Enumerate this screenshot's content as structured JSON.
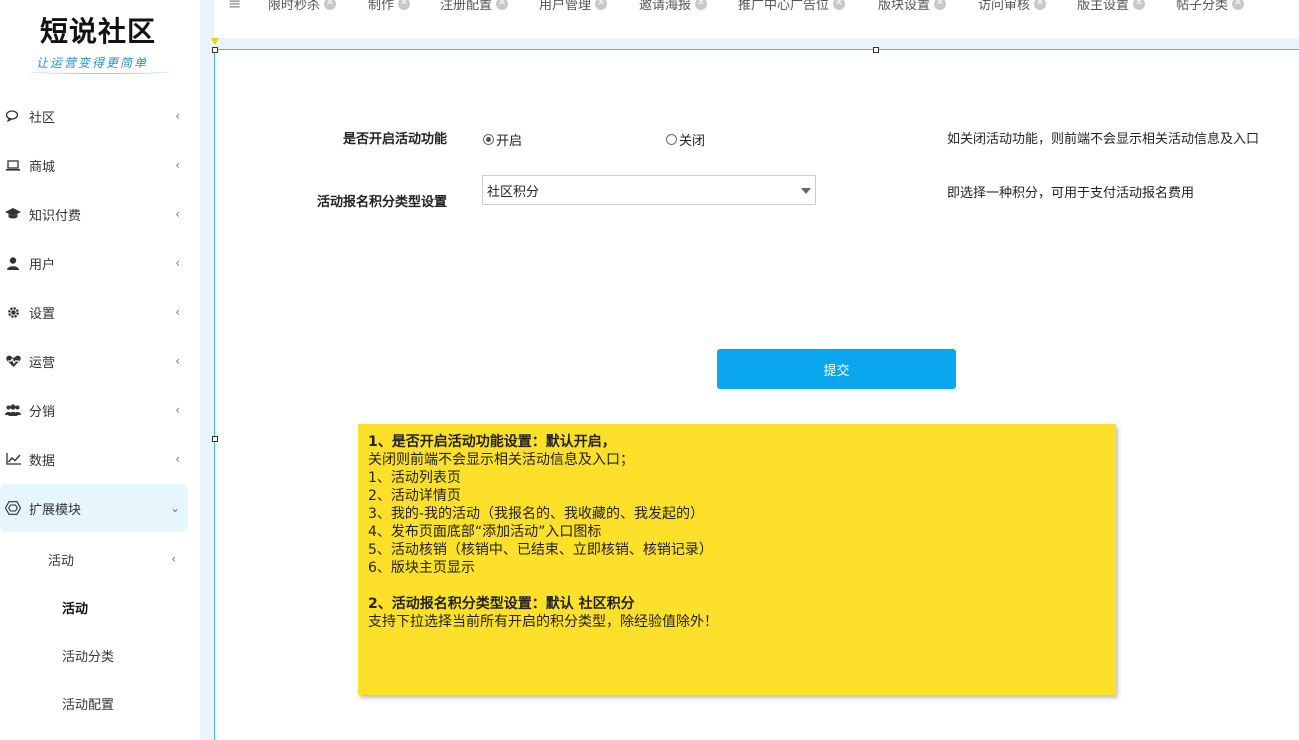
{
  "logo": {
    "title": "短说社区",
    "subtitle": "让运营变得更简单"
  },
  "sidebar": {
    "items": [
      {
        "label": "社区",
        "icon": "chat-icon"
      },
      {
        "label": "商城",
        "icon": "laptop-icon"
      },
      {
        "label": "知识付费",
        "icon": "graduation-cap-icon"
      },
      {
        "label": "用户",
        "icon": "user-icon"
      },
      {
        "label": "设置",
        "icon": "gear-icon"
      },
      {
        "label": "运营",
        "icon": "heartbeat-icon"
      },
      {
        "label": "分销",
        "icon": "users-icon"
      },
      {
        "label": "数据",
        "icon": "line-chart-icon"
      },
      {
        "label": "扩展模块",
        "icon": "cube-icon"
      }
    ],
    "sub_group": "活动",
    "sub_items": [
      "活动",
      "活动分类",
      "活动配置"
    ]
  },
  "tabs": [
    "限时秒杀",
    "制作",
    "注册配置",
    "用户管理",
    "邀请海报",
    "推广中心广告位",
    "版块设置",
    "访问审核",
    "版主设置",
    "帖子分类"
  ],
  "form": {
    "enable_label": "是否开启活动功能",
    "radio_on": "开启",
    "radio_off": "关闭",
    "enable_hint": "如关闭活动功能，则前端不会显示相关活动信息及入口",
    "score_label": "活动报名积分类型设置",
    "score_value": "社区积分",
    "score_hint": "即选择一种积分，可用于支付活动报名费用",
    "submit": "提交"
  },
  "note": {
    "h1": "1、是否开启活动功能设置：默认开启，",
    "l1": "关闭则前端不会显示相关活动信息及入口；",
    "l2": "1、活动列表页",
    "l3": "2、活动详情页",
    "l4": "3、我的-我的活动（我报名的、我收藏的、我发起的）",
    "l5": "4、发布页面底部“添加活动”入口图标",
    "l6": "5、活动核销（核销中、已结束、立即核销、核销记录）",
    "l7": "6、版块主页显示",
    "h2": "2、活动报名积分类型设置：默认 社区积分",
    "l8": "支持下拉选择当前所有开启的积分类型，除经验值除外！"
  }
}
